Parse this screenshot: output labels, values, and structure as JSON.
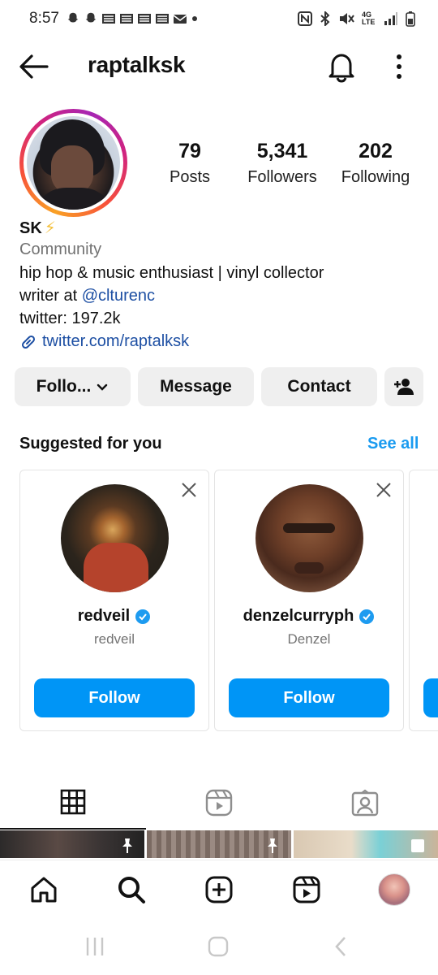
{
  "status_bar": {
    "time": "8:57",
    "notification_icons": [
      "snapchat-icon",
      "snapchat-icon",
      "mail-icon",
      "mail-icon",
      "mail-icon",
      "mail-icon",
      "gmail-icon",
      "dot-icon"
    ],
    "network": "4G LTE",
    "right_icons": [
      "nfc-icon",
      "bluetooth-icon",
      "mute-icon",
      "signal-icon",
      "battery-icon"
    ]
  },
  "header": {
    "username": "raptalksk"
  },
  "profile": {
    "stats": [
      {
        "value": "79",
        "label": "Posts"
      },
      {
        "value": "5,341",
        "label": "Followers"
      },
      {
        "value": "202",
        "label": "Following"
      }
    ],
    "display_name": "SK",
    "emoji": "⚡",
    "category": "Community",
    "bio_line_1": "hip hop & music enthusiast | vinyl collector",
    "bio_line_2_prefix": "writer at ",
    "bio_line_2_mention": "@clturenc",
    "bio_line_3": "twitter: 197.2k",
    "link": "twitter.com/raptalksk"
  },
  "actions": {
    "following_label": "Follo...",
    "message_label": "Message",
    "contact_label": "Contact"
  },
  "suggested": {
    "title": "Suggested for you",
    "see_all": "See all",
    "cards": [
      {
        "name": "redveil",
        "subtitle": "redveil",
        "verified": true,
        "follow_label": "Follow"
      },
      {
        "name": "denzelcurryph",
        "subtitle": "Denzel",
        "verified": true,
        "follow_label": "Follow"
      }
    ]
  },
  "tabs": [
    "grid-icon",
    "reels-icon",
    "tagged-icon"
  ],
  "bottom_nav": [
    "home-icon",
    "search-icon",
    "create-icon",
    "reels-icon",
    "profile-avatar"
  ],
  "colors": {
    "accent_blue": "#0095f6",
    "link_blue": "#1d4fa3",
    "see_all_blue": "#1a9bf0",
    "button_gray": "#efefef",
    "muted_text": "#737373"
  }
}
